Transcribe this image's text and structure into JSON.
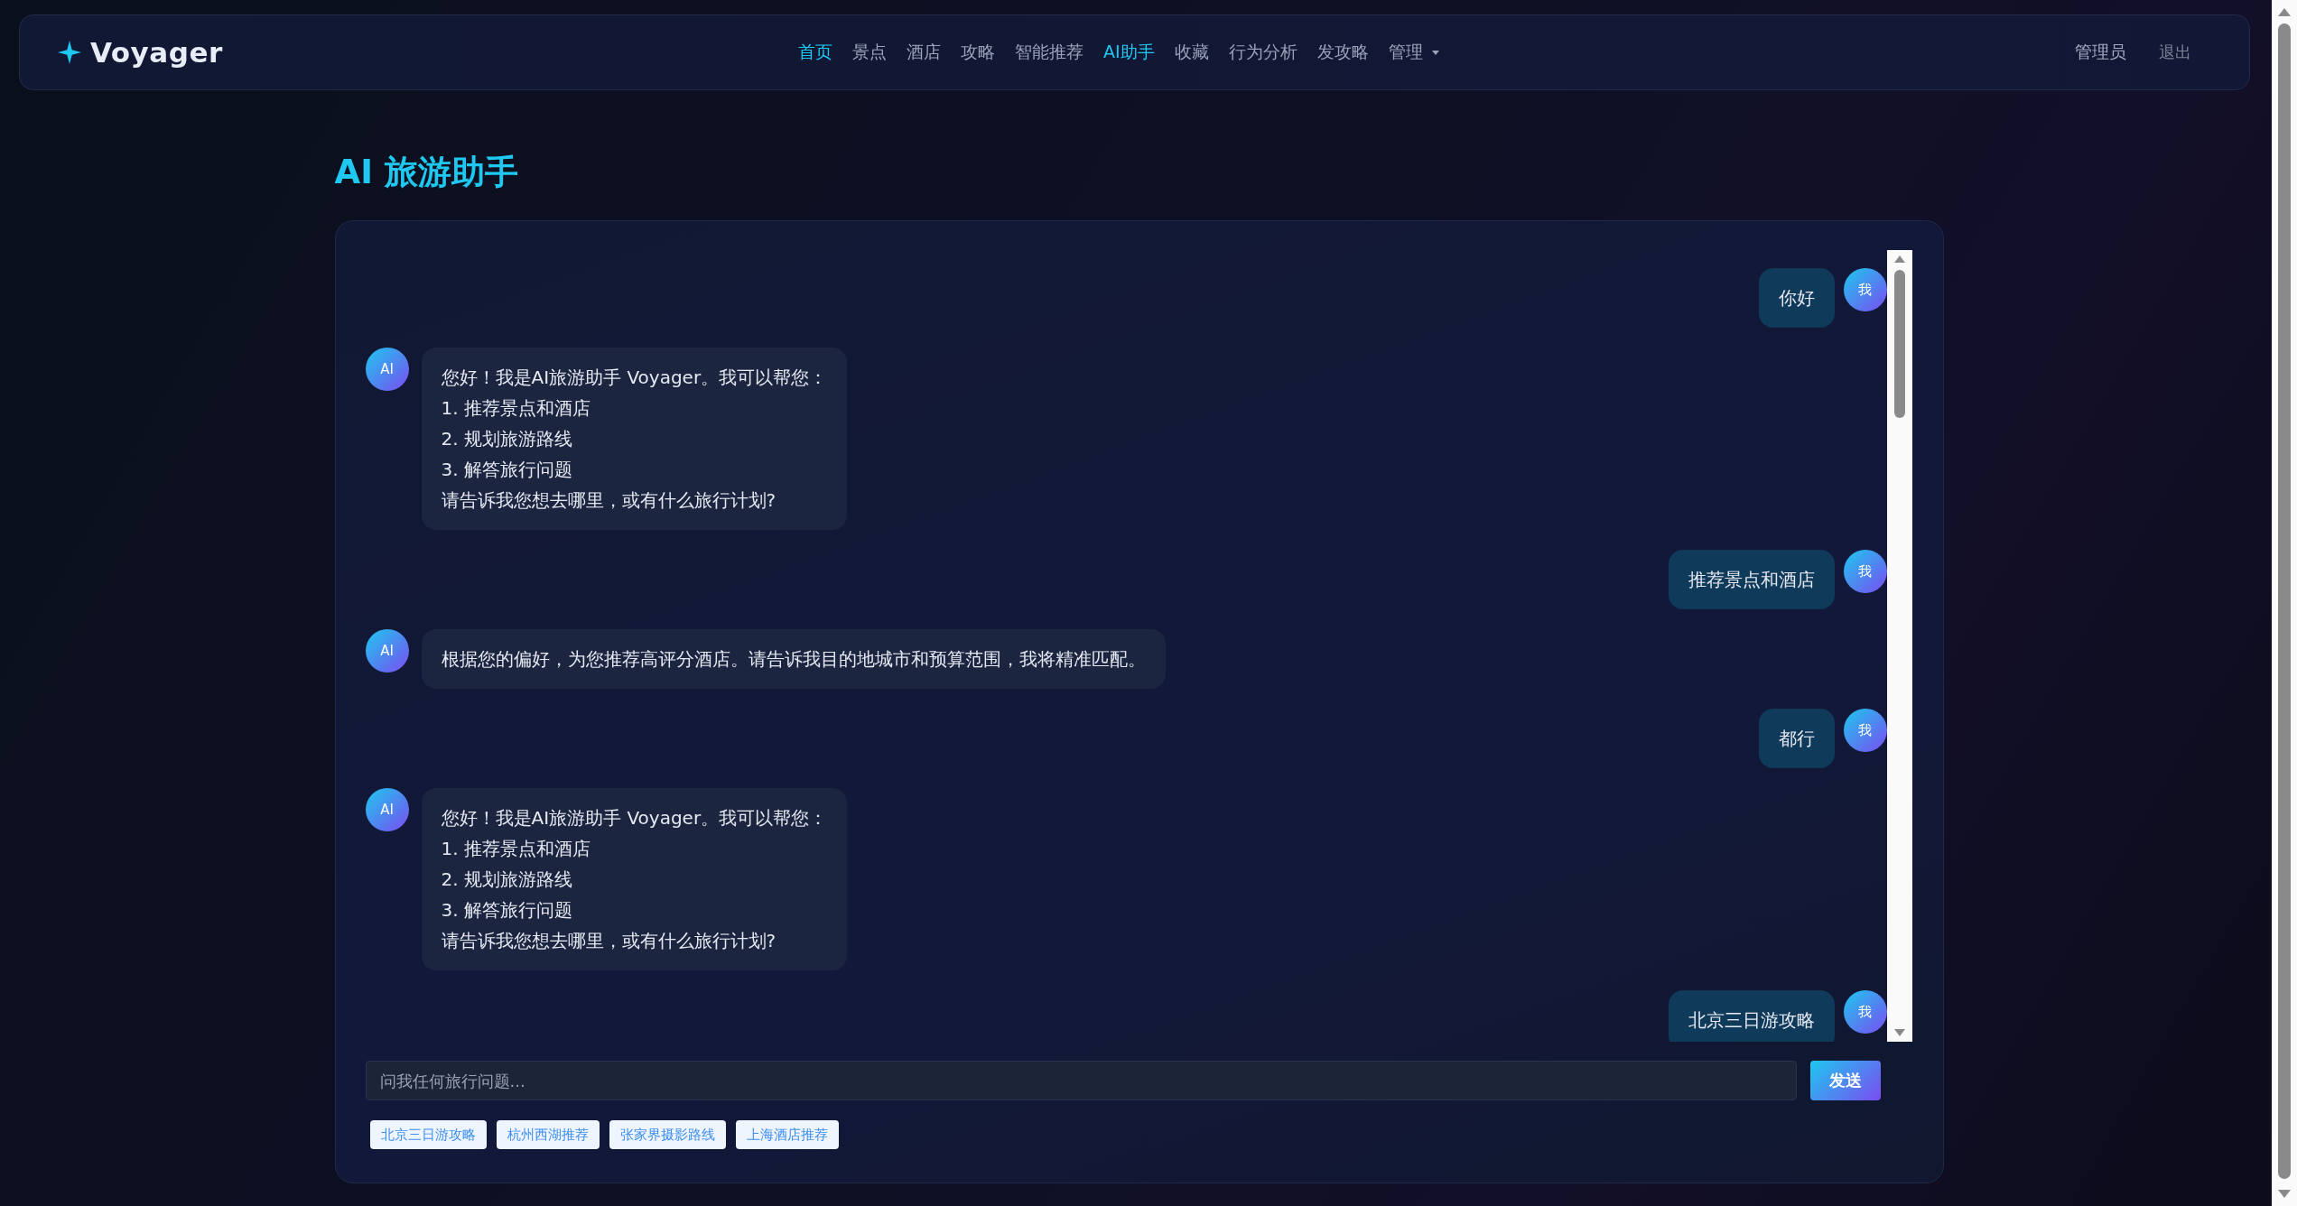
{
  "nav": {
    "logo": "Voyager",
    "items": [
      {
        "label": "首页",
        "selected": true,
        "kind": "link"
      },
      {
        "label": "景点",
        "selected": false,
        "kind": "link"
      },
      {
        "label": "酒店",
        "selected": false,
        "kind": "link"
      },
      {
        "label": "攻略",
        "selected": false,
        "kind": "link"
      },
      {
        "label": "智能推荐",
        "selected": false,
        "kind": "link"
      },
      {
        "label": "AI助手",
        "selected": true,
        "kind": "link"
      },
      {
        "label": "收藏",
        "selected": false,
        "kind": "link"
      },
      {
        "label": "行为分析",
        "selected": false,
        "kind": "link"
      },
      {
        "label": "发攻略",
        "selected": false,
        "kind": "link"
      },
      {
        "label": "管理",
        "selected": false,
        "kind": "dropdown"
      }
    ],
    "user": "管理员",
    "logout": "退出"
  },
  "title": "AI 旅游助手",
  "messages": [
    {
      "kind": "user",
      "avatar": "我",
      "lines": [
        "你好"
      ]
    },
    {
      "kind": "ai",
      "avatar": "AI",
      "lines": [
        "您好！我是AI旅游助手 Voyager。我可以帮您：",
        "1. 推荐景点和酒店",
        "2. 规划旅游路线",
        "3. 解答旅行问题",
        "请告诉我您想去哪里，或有什么旅行计划?"
      ]
    },
    {
      "kind": "user",
      "avatar": "我",
      "lines": [
        "推荐景点和酒店"
      ]
    },
    {
      "kind": "ai",
      "avatar": "AI",
      "lines": [
        "根据您的偏好，为您推荐高评分酒店。请告诉我目的地城市和预算范围，我将精准匹配。"
      ]
    },
    {
      "kind": "user",
      "avatar": "我",
      "lines": [
        "都行"
      ]
    },
    {
      "kind": "ai",
      "avatar": "AI",
      "lines": [
        "您好！我是AI旅游助手 Voyager。我可以帮您：",
        "1. 推荐景点和酒店",
        "2. 规划旅游路线",
        "3. 解答旅行问题",
        "请告诉我您想去哪里，或有什么旅行计划?"
      ]
    },
    {
      "kind": "user",
      "avatar": "我",
      "lines": [
        "北京三日游攻略"
      ]
    }
  ],
  "input": {
    "placeholder": "问我任何旅行问题..."
  },
  "send_button": "发送",
  "suggestions": [
    "北京三日游攻略",
    "杭州西湖推荐",
    "张家界摄影路线",
    "上海酒店推荐"
  ]
}
